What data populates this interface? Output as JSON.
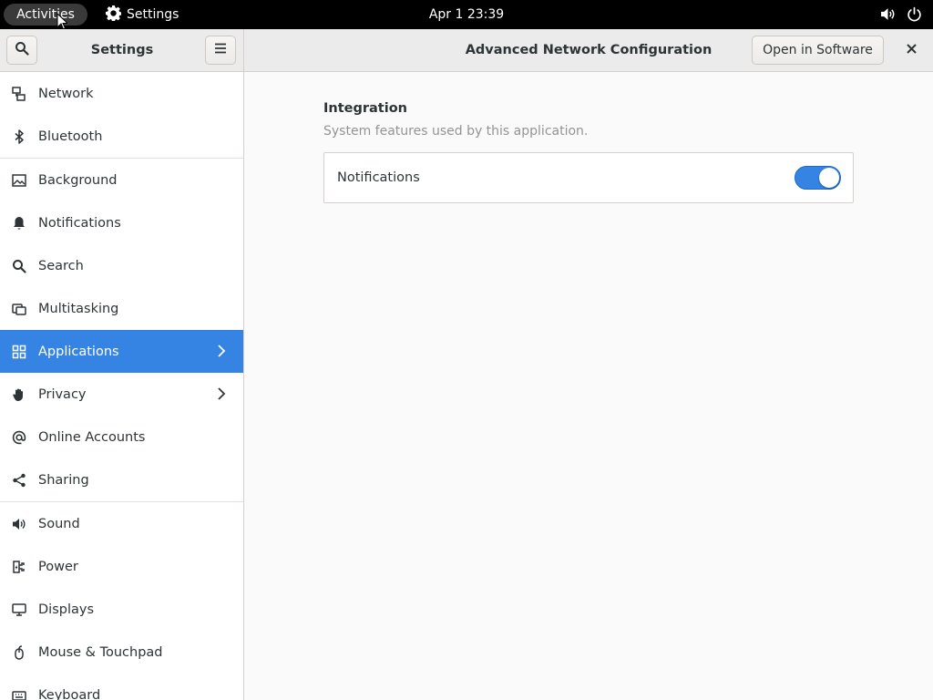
{
  "topbar": {
    "activities": "Activities",
    "app_name": "Settings",
    "clock": "Apr 1  23:39",
    "icons": [
      "gear-icon",
      "volume-icon",
      "power-icon"
    ]
  },
  "headerbar": {
    "sidebar_title": "Settings",
    "title": "Advanced Network Configuration",
    "open_in_software": "Open in Software",
    "icons": [
      "search-icon",
      "hamburger-menu-icon",
      "close-icon"
    ]
  },
  "sidebar": {
    "items": [
      {
        "label": "Network",
        "icon": "network-icon"
      },
      {
        "label": "Bluetooth",
        "icon": "bluetooth-icon"
      },
      {
        "label": "Background",
        "icon": "image-icon"
      },
      {
        "label": "Notifications",
        "icon": "bell-icon"
      },
      {
        "label": "Search",
        "icon": "search-icon"
      },
      {
        "label": "Multitasking",
        "icon": "multitasking-icon"
      },
      {
        "label": "Applications",
        "icon": "grid-icon",
        "selected": true
      },
      {
        "label": "Privacy",
        "icon": "hand-icon"
      },
      {
        "label": "Online Accounts",
        "icon": "at-icon"
      },
      {
        "label": "Sharing",
        "icon": "share-icon"
      },
      {
        "label": "Sound",
        "icon": "speaker-icon"
      },
      {
        "label": "Power",
        "icon": "power-plug-icon"
      },
      {
        "label": "Displays",
        "icon": "display-icon"
      },
      {
        "label": "Mouse & Touchpad",
        "icon": "mouse-icon"
      },
      {
        "label": "Keyboard",
        "icon": "keyboard-icon"
      }
    ]
  },
  "content": {
    "section_title": "Integration",
    "section_subtitle": "System features used by this application.",
    "rows": [
      {
        "label": "Notifications",
        "toggle_on": true
      }
    ]
  },
  "colors": {
    "accent": "#3584e4",
    "sidebar_bg": "#ffffff",
    "content_bg": "#fafafa",
    "topbar_bg": "#000000"
  }
}
